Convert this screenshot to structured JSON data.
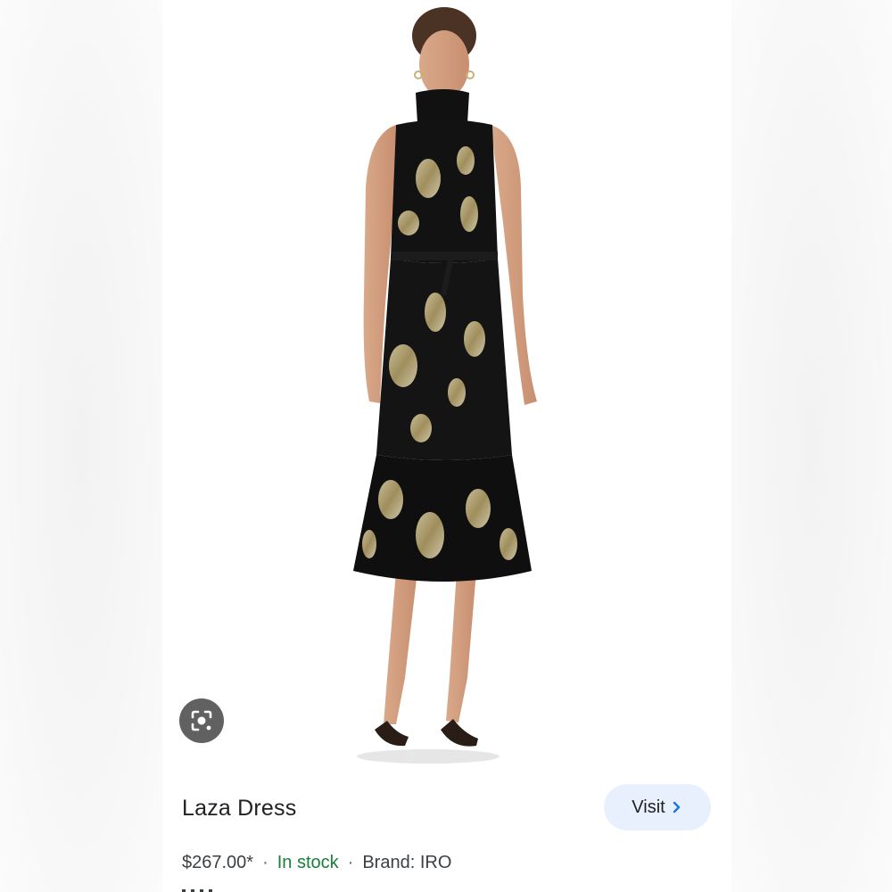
{
  "product": {
    "title": "Laza Dress",
    "price": "$267.00*",
    "separator": "·",
    "stock_status": "In stock",
    "brand": "Brand: IRO"
  },
  "actions": {
    "visit_label": "Visit",
    "lens_icon": "google-lens-icon",
    "visit_icon": "chevron-right-icon"
  },
  "image": {
    "subject": "product-photo"
  },
  "colors": {
    "stock": "#188038",
    "visit_bg": "#e8f0fe",
    "visit_chevron": "#1a73e8",
    "lens_bg": "#616161"
  }
}
